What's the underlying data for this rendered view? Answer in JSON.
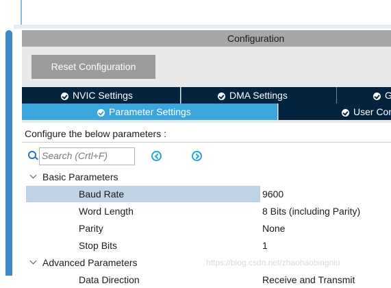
{
  "panel": {
    "title": "Configuration",
    "reset_label": "Reset Configuration"
  },
  "tabs_row1": [
    {
      "label": "NVIC Settings"
    },
    {
      "label": "DMA Settings"
    },
    {
      "label": "GPIO Settings"
    }
  ],
  "tabs_row2": [
    {
      "label": "Parameter Settings"
    },
    {
      "label": "User Constants"
    }
  ],
  "hint": "Configure the below parameters :",
  "search": {
    "placeholder": "Search (Crtl+F)"
  },
  "groups": {
    "basic": "Basic Parameters",
    "advanced": "Advanced Parameters"
  },
  "params": [
    {
      "name": "Baud Rate",
      "value": "9600"
    },
    {
      "name": "Word Length",
      "value": "8 Bits (including Parity)"
    },
    {
      "name": "Parity",
      "value": "None"
    },
    {
      "name": "Stop Bits",
      "value": "1"
    },
    {
      "name": "Data Direction",
      "value": "Receive and Transmit"
    }
  ],
  "watermark": "https://blog.csdn.net/zhaohaobingniu",
  "colors": {
    "tab_dark": "#03233e",
    "tab_active": "#3aa6dc",
    "header_gray": "#a7a7a7",
    "selected_row": "#bfd3e6",
    "scroll_thumb": "#3d8ac8"
  }
}
